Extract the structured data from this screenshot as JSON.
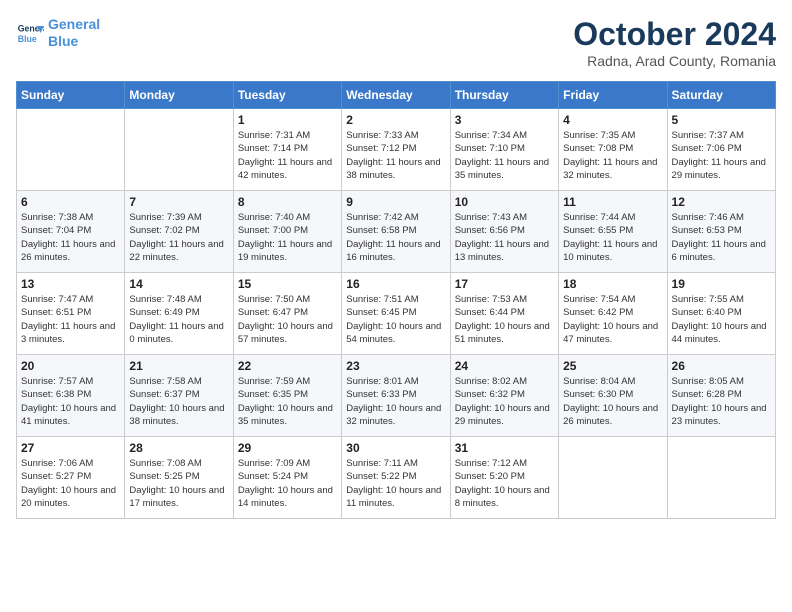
{
  "header": {
    "logo_line1": "General",
    "logo_line2": "Blue",
    "month_title": "October 2024",
    "subtitle": "Radna, Arad County, Romania"
  },
  "weekdays": [
    "Sunday",
    "Monday",
    "Tuesday",
    "Wednesday",
    "Thursday",
    "Friday",
    "Saturday"
  ],
  "weeks": [
    [
      {
        "day": "",
        "info": ""
      },
      {
        "day": "",
        "info": ""
      },
      {
        "day": "1",
        "info": "Sunrise: 7:31 AM\nSunset: 7:14 PM\nDaylight: 11 hours and 42 minutes."
      },
      {
        "day": "2",
        "info": "Sunrise: 7:33 AM\nSunset: 7:12 PM\nDaylight: 11 hours and 38 minutes."
      },
      {
        "day": "3",
        "info": "Sunrise: 7:34 AM\nSunset: 7:10 PM\nDaylight: 11 hours and 35 minutes."
      },
      {
        "day": "4",
        "info": "Sunrise: 7:35 AM\nSunset: 7:08 PM\nDaylight: 11 hours and 32 minutes."
      },
      {
        "day": "5",
        "info": "Sunrise: 7:37 AM\nSunset: 7:06 PM\nDaylight: 11 hours and 29 minutes."
      }
    ],
    [
      {
        "day": "6",
        "info": "Sunrise: 7:38 AM\nSunset: 7:04 PM\nDaylight: 11 hours and 26 minutes."
      },
      {
        "day": "7",
        "info": "Sunrise: 7:39 AM\nSunset: 7:02 PM\nDaylight: 11 hours and 22 minutes."
      },
      {
        "day": "8",
        "info": "Sunrise: 7:40 AM\nSunset: 7:00 PM\nDaylight: 11 hours and 19 minutes."
      },
      {
        "day": "9",
        "info": "Sunrise: 7:42 AM\nSunset: 6:58 PM\nDaylight: 11 hours and 16 minutes."
      },
      {
        "day": "10",
        "info": "Sunrise: 7:43 AM\nSunset: 6:56 PM\nDaylight: 11 hours and 13 minutes."
      },
      {
        "day": "11",
        "info": "Sunrise: 7:44 AM\nSunset: 6:55 PM\nDaylight: 11 hours and 10 minutes."
      },
      {
        "day": "12",
        "info": "Sunrise: 7:46 AM\nSunset: 6:53 PM\nDaylight: 11 hours and 6 minutes."
      }
    ],
    [
      {
        "day": "13",
        "info": "Sunrise: 7:47 AM\nSunset: 6:51 PM\nDaylight: 11 hours and 3 minutes."
      },
      {
        "day": "14",
        "info": "Sunrise: 7:48 AM\nSunset: 6:49 PM\nDaylight: 11 hours and 0 minutes."
      },
      {
        "day": "15",
        "info": "Sunrise: 7:50 AM\nSunset: 6:47 PM\nDaylight: 10 hours and 57 minutes."
      },
      {
        "day": "16",
        "info": "Sunrise: 7:51 AM\nSunset: 6:45 PM\nDaylight: 10 hours and 54 minutes."
      },
      {
        "day": "17",
        "info": "Sunrise: 7:53 AM\nSunset: 6:44 PM\nDaylight: 10 hours and 51 minutes."
      },
      {
        "day": "18",
        "info": "Sunrise: 7:54 AM\nSunset: 6:42 PM\nDaylight: 10 hours and 47 minutes."
      },
      {
        "day": "19",
        "info": "Sunrise: 7:55 AM\nSunset: 6:40 PM\nDaylight: 10 hours and 44 minutes."
      }
    ],
    [
      {
        "day": "20",
        "info": "Sunrise: 7:57 AM\nSunset: 6:38 PM\nDaylight: 10 hours and 41 minutes."
      },
      {
        "day": "21",
        "info": "Sunrise: 7:58 AM\nSunset: 6:37 PM\nDaylight: 10 hours and 38 minutes."
      },
      {
        "day": "22",
        "info": "Sunrise: 7:59 AM\nSunset: 6:35 PM\nDaylight: 10 hours and 35 minutes."
      },
      {
        "day": "23",
        "info": "Sunrise: 8:01 AM\nSunset: 6:33 PM\nDaylight: 10 hours and 32 minutes."
      },
      {
        "day": "24",
        "info": "Sunrise: 8:02 AM\nSunset: 6:32 PM\nDaylight: 10 hours and 29 minutes."
      },
      {
        "day": "25",
        "info": "Sunrise: 8:04 AM\nSunset: 6:30 PM\nDaylight: 10 hours and 26 minutes."
      },
      {
        "day": "26",
        "info": "Sunrise: 8:05 AM\nSunset: 6:28 PM\nDaylight: 10 hours and 23 minutes."
      }
    ],
    [
      {
        "day": "27",
        "info": "Sunrise: 7:06 AM\nSunset: 5:27 PM\nDaylight: 10 hours and 20 minutes."
      },
      {
        "day": "28",
        "info": "Sunrise: 7:08 AM\nSunset: 5:25 PM\nDaylight: 10 hours and 17 minutes."
      },
      {
        "day": "29",
        "info": "Sunrise: 7:09 AM\nSunset: 5:24 PM\nDaylight: 10 hours and 14 minutes."
      },
      {
        "day": "30",
        "info": "Sunrise: 7:11 AM\nSunset: 5:22 PM\nDaylight: 10 hours and 11 minutes."
      },
      {
        "day": "31",
        "info": "Sunrise: 7:12 AM\nSunset: 5:20 PM\nDaylight: 10 hours and 8 minutes."
      },
      {
        "day": "",
        "info": ""
      },
      {
        "day": "",
        "info": ""
      }
    ]
  ]
}
